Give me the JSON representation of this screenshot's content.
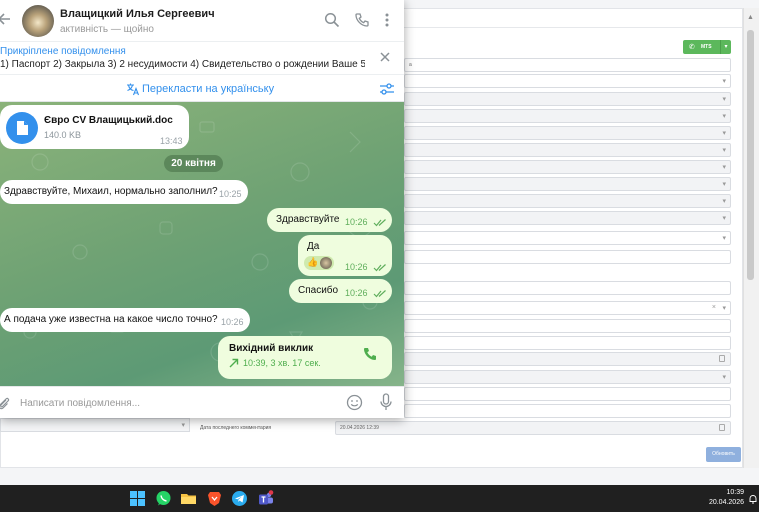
{
  "crm": {
    "field_snippet": "а",
    "mts_label": "MTS",
    "last_comment_date_label": "Дата последнего комментария",
    "last_comment_date_value": "20.04.2026 12:39",
    "refresh_label": "Обновить"
  },
  "telegram": {
    "contact_name": "Влащицкий Илья Сергеевич",
    "contact_status": "активність — щойно",
    "pinned_title": "Прикріплене повідомлення",
    "pinned_text": "1) Паспорт 2) Закрыла 3) 2 несудимости 4) Свидетельство о рождении Ваше 5) ...",
    "translate_label": "Перекласти на українську",
    "composer_placeholder": "Написати повідомлення...",
    "messages": {
      "file": {
        "name": "Євро CV Влащицький.doc",
        "size": "140.0 KB",
        "time": "13:43"
      },
      "date_separator": "20 квітня",
      "m1": {
        "text": "Здравствуйте, Михаил, нормально заполнил?",
        "time": "10:25"
      },
      "m2": {
        "text": "Здравствуйте",
        "time": "10:26"
      },
      "m3": {
        "text": "Да",
        "time": "10:26",
        "reaction": "👍"
      },
      "m4": {
        "text": "Спасибо",
        "time": "10:26"
      },
      "m5": {
        "text": "А подача уже известна на какое число точно?",
        "time": "10:26"
      },
      "call": {
        "title": "Вихідний виклик",
        "info": "10:39, 3 хв. 17 сек."
      }
    }
  },
  "taskbar": {
    "time": "10:39",
    "date": "20.04.2026"
  },
  "colors": {
    "telegram_accent": "#3390ec",
    "outgoing_bubble": "#effdde",
    "mts_green": "#5cb85c",
    "taskbar": "#202020"
  }
}
